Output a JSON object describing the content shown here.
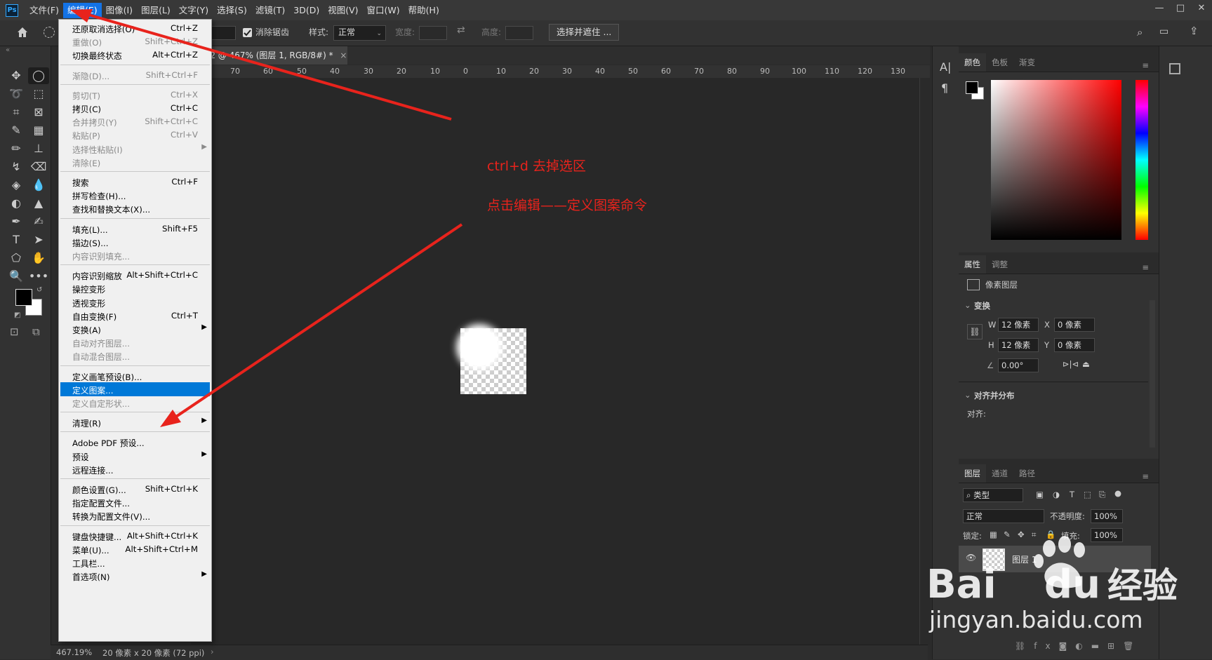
{
  "menubar": {
    "items": [
      "文件(F)",
      "编辑(E)",
      "图像(I)",
      "图层(L)",
      "文字(Y)",
      "选择(S)",
      "滤镜(T)",
      "3D(D)",
      "视图(V)",
      "窗口(W)",
      "帮助(H)"
    ],
    "active_index": 1,
    "window_controls": [
      "—",
      "□",
      "✕"
    ]
  },
  "options": {
    "antialias": "消除锯齿",
    "style_label": "样式:",
    "style_value": "正常",
    "width_label": "宽度:",
    "height_label": "高度:",
    "select_mask": "选择并遮住 ..."
  },
  "document": {
    "tab_title": "…-2 @ 467% (图层 1, RGB/8#) *",
    "ruler_labels": [
      "70",
      "60",
      "50",
      "40",
      "30",
      "20",
      "10",
      "0",
      "10",
      "20",
      "30",
      "40",
      "50",
      "60",
      "70",
      "80",
      "90",
      "100",
      "110",
      "120",
      "130"
    ]
  },
  "status": {
    "zoom": "467.19%",
    "doc_info": "20 像素 x 20 像素 (72 ppi)"
  },
  "edit_menu": {
    "items": [
      {
        "label": "还原取消选择(O)",
        "shortcut": "Ctrl+Z",
        "disabled": false
      },
      {
        "label": "重做(O)",
        "shortcut": "Shift+Ctrl+Z",
        "disabled": true
      },
      {
        "label": "切换最终状态",
        "shortcut": "Alt+Ctrl+Z",
        "disabled": false
      },
      {
        "sep": true
      },
      {
        "label": "渐隐(D)...",
        "shortcut": "Shift+Ctrl+F",
        "disabled": true
      },
      {
        "sep": true
      },
      {
        "label": "剪切(T)",
        "shortcut": "Ctrl+X",
        "disabled": true
      },
      {
        "label": "拷贝(C)",
        "shortcut": "Ctrl+C",
        "disabled": false
      },
      {
        "label": "合并拷贝(Y)",
        "shortcut": "Shift+Ctrl+C",
        "disabled": true
      },
      {
        "label": "粘贴(P)",
        "shortcut": "Ctrl+V",
        "disabled": true
      },
      {
        "label": "选择性粘贴(I)",
        "shortcut": "",
        "disabled": true,
        "submenu": true
      },
      {
        "label": "清除(E)",
        "shortcut": "",
        "disabled": true
      },
      {
        "sep": true
      },
      {
        "label": "搜索",
        "shortcut": "Ctrl+F",
        "disabled": false
      },
      {
        "label": "拼写检查(H)...",
        "shortcut": "",
        "disabled": false
      },
      {
        "label": "查找和替换文本(X)...",
        "shortcut": "",
        "disabled": false
      },
      {
        "sep": true
      },
      {
        "label": "填充(L)...",
        "shortcut": "Shift+F5",
        "disabled": false
      },
      {
        "label": "描边(S)...",
        "shortcut": "",
        "disabled": false
      },
      {
        "label": "内容识别填充...",
        "shortcut": "",
        "disabled": true
      },
      {
        "sep": true
      },
      {
        "label": "内容识别缩放",
        "shortcut": "Alt+Shift+Ctrl+C",
        "disabled": false
      },
      {
        "label": "操控变形",
        "shortcut": "",
        "disabled": false
      },
      {
        "label": "透视变形",
        "shortcut": "",
        "disabled": false
      },
      {
        "label": "自由变换(F)",
        "shortcut": "Ctrl+T",
        "disabled": false
      },
      {
        "label": "变换(A)",
        "shortcut": "",
        "disabled": false,
        "submenu": true
      },
      {
        "label": "自动对齐图层...",
        "shortcut": "",
        "disabled": true
      },
      {
        "label": "自动混合图层...",
        "shortcut": "",
        "disabled": true
      },
      {
        "sep": true
      },
      {
        "label": "定义画笔预设(B)...",
        "shortcut": "",
        "disabled": false
      },
      {
        "label": "定义图案...",
        "shortcut": "",
        "disabled": false,
        "highlighted": true
      },
      {
        "label": "定义自定形状...",
        "shortcut": "",
        "disabled": true
      },
      {
        "sep": true
      },
      {
        "label": "清理(R)",
        "shortcut": "",
        "disabled": false,
        "submenu": true
      },
      {
        "sep": true
      },
      {
        "label": "Adobe PDF 预设...",
        "shortcut": "",
        "disabled": false
      },
      {
        "label": "预设",
        "shortcut": "",
        "disabled": false,
        "submenu": true
      },
      {
        "label": "远程连接...",
        "shortcut": "",
        "disabled": false
      },
      {
        "sep": true
      },
      {
        "label": "颜色设置(G)...",
        "shortcut": "Shift+Ctrl+K",
        "disabled": false
      },
      {
        "label": "指定配置文件...",
        "shortcut": "",
        "disabled": false
      },
      {
        "label": "转换为配置文件(V)...",
        "shortcut": "",
        "disabled": false
      },
      {
        "sep": true
      },
      {
        "label": "键盘快捷键...",
        "shortcut": "Alt+Shift+Ctrl+K",
        "disabled": false
      },
      {
        "label": "菜单(U)...",
        "shortcut": "Alt+Shift+Ctrl+M",
        "disabled": false
      },
      {
        "label": "工具栏...",
        "shortcut": "",
        "disabled": false
      },
      {
        "label": "首选项(N)",
        "shortcut": "",
        "disabled": false,
        "submenu": true
      }
    ]
  },
  "annotations": {
    "line1": "ctrl+d 去掉选区",
    "line2": "点击编辑——定义图案命令",
    "color": "#e8231c"
  },
  "color_panel": {
    "tabs": [
      "颜色",
      "色板",
      "渐变"
    ],
    "hue_color": "#ff0000"
  },
  "properties_panel": {
    "tabs": [
      "属性",
      "调整"
    ],
    "layer_type": "像素图层",
    "transform_title": "变换",
    "w_label": "W",
    "w_value": "12 像素",
    "h_label": "H",
    "h_value": "12 像素",
    "x_label": "X",
    "x_value": "0 像素",
    "y_label": "Y",
    "y_value": "0 像素",
    "angle_value": "0.00°",
    "align_title": "对齐并分布",
    "align_label": "对齐:"
  },
  "layers_panel": {
    "tabs": [
      "图层",
      "通道",
      "路径"
    ],
    "filter_kind": "类型",
    "blend_mode": "正常",
    "opacity_label": "不透明度:",
    "opacity_value": "100%",
    "lock_label": "锁定:",
    "fill_label": "填充:",
    "fill_value": "100%",
    "layer_name": "图层 1"
  },
  "watermark": {
    "brand": "Bai",
    "brand2": "du",
    "product": "经验",
    "url": "jingyan.baidu.com"
  }
}
